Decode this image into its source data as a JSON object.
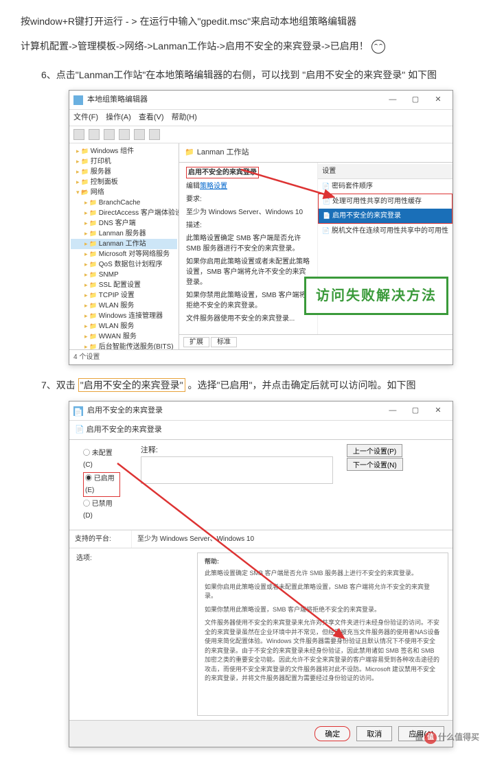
{
  "intro": {
    "line1": "按window+R键打开运行 - > 在运行中输入\"gpedit.msc\"来启动本地组策略编辑器",
    "line2": "计算机配置->管理模板->网络->Lanman工作站->启用不安全的来宾登录->已启用！"
  },
  "step6": {
    "text_a": "6、点击\"Lanman工作站\"在本地策略编辑器的右侧，可以找到",
    "hl": "\"启用不安全的来宾登录\"",
    "text_b": "如下图"
  },
  "step7": {
    "text_a": "7、双击",
    "hl": "\"启用不安全的来宾登录\"",
    "text_b": "。选择\"已启用\"，并点击确定后就可以访问啦。如下图"
  },
  "gpedit": {
    "title": "本地组策略编辑器",
    "menus": [
      "文件(F)",
      "操作(A)",
      "查看(V)",
      "帮助(H)"
    ],
    "tree": [
      {
        "t": "Windows 组件",
        "i": 1
      },
      {
        "t": "打印机",
        "i": 1
      },
      {
        "t": "服务器",
        "i": 1
      },
      {
        "t": "控制面板",
        "i": 1
      },
      {
        "t": "网络",
        "i": 1,
        "open": true
      },
      {
        "t": "BranchCache",
        "i": 2
      },
      {
        "t": "DirectAccess 客户端体验设",
        "i": 2
      },
      {
        "t": "DNS 客户端",
        "i": 2
      },
      {
        "t": "Lanman 服务器",
        "i": 2
      },
      {
        "t": "Lanman 工作站",
        "i": 2,
        "sel": true
      },
      {
        "t": "Microsoft 对等网络服务",
        "i": 2
      },
      {
        "t": "QoS 数据包计划程序",
        "i": 2
      },
      {
        "t": "SNMP",
        "i": 2
      },
      {
        "t": "SSL 配置设置",
        "i": 2
      },
      {
        "t": "TCPIP 设置",
        "i": 2
      },
      {
        "t": "WLAN 服务",
        "i": 2
      },
      {
        "t": "Windows 连接管理器",
        "i": 2
      },
      {
        "t": "WLAN 服务",
        "i": 2
      },
      {
        "t": "WWAN 服务",
        "i": 2
      },
      {
        "t": "后台智能传送服务(BITS)",
        "i": 2
      }
    ],
    "pane_title": "Lanman 工作站",
    "setting_title": "启用不安全的来宾登录",
    "edit_link_label": "编辑",
    "edit_link": "策略设置",
    "req_label": "要求:",
    "req_text": "至少为 Windows Server、Windows 10",
    "desc_label": "描述:",
    "desc1": "此策略设置确定 SMB 客户端是否允许 SMB 服务器进行不安全的来宾登录。",
    "desc2": "如果你启用此策略设置或者未配置此策略设置，SMB 客户端将允许不安全的来宾登录。",
    "desc3": "如果你禁用此策略设置，SMB 客户端将拒绝不安全的来宾登录。",
    "desc4": "文件服务器使用不安全的来宾登录...",
    "col_header": "设置",
    "items": [
      "密码套件顺序",
      "处理可用性共享的可用性缓存",
      "启用不安全的来宾登录",
      "脱机文件在连续可用性共享中的可用性"
    ],
    "tabs": [
      "扩展",
      "标准"
    ],
    "status": "4 个设置",
    "callout": "访问失败解决方法"
  },
  "dialog": {
    "title": "启用不安全的来宾登录",
    "head2": "启用不安全的来宾登录",
    "prev": "上一个设置(P)",
    "next": "下一个设置(N)",
    "opt_nc": "未配置(C)",
    "opt_en": "已启用(E)",
    "opt_dis": "已禁用(D)",
    "notes": "注释:",
    "support_label": "支持的平台:",
    "support_text": "至少为 Windows Server、Windows 10",
    "options_label": "选项:",
    "help_label": "帮助:",
    "help": [
      "此策略设置确定 SMB 客户端是否允许 SMB 服务器上进行不安全的来宾登录。",
      "如果你启用此策略设置或者未配置此策略设置，SMB 客户端将允许不安全的来宾登录。",
      "如果你禁用此策略设置，SMB 客户端将拒绝不安全的来宾登录。",
      "文件服务器使用不安全的来宾登录来允许对共享文件夹进行未经身份验证的访问。不安全的来宾登录虽然在企业环境中并不常见，但经常被充当文件服务器的使用者NAS设备使用来简化配置体验。Windows 文件服务器需要身份验证且默认情况下不使用不安全的来宾登录。由于不安全的来宾登录未经身份验证，因此禁用诸如 SMB 签名和 SMB 加密之类的重要安全功能。因此允许不安全来宾登录的客户端容易受到各种攻击途径的攻击，而使用不安全来宾登录的文件服务器将对此不设防。Microsoft 建议禁用不安全的来宾登录，并将文件服务器配置为需要经过身份验证的访问。"
    ],
    "ok": "确定",
    "cancel": "取消",
    "apply": "应用(A)"
  },
  "watermark": "值(得)什么值得买"
}
